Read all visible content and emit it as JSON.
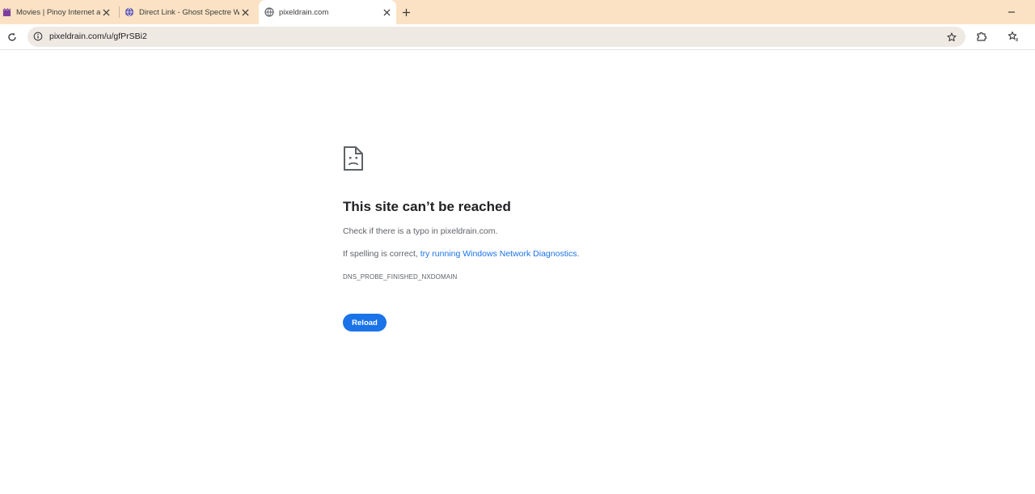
{
  "browser": {
    "tabs": [
      {
        "title": "Movies | Pinoy Internet and",
        "favicon": "film-icon",
        "active": false
      },
      {
        "title": "Direct Link - Ghost Spectre Wi",
        "favicon": "globe-purple-icon",
        "active": false
      },
      {
        "title": "pixeldrain.com",
        "favicon": "globe-icon",
        "active": true
      }
    ],
    "new_tab_icon": "plus-icon",
    "minimize_icon": "minimize-icon",
    "address": "pixeldrain.com/u/gfPrSBi2",
    "site_info_icon": "info-icon",
    "bookmark_icon": "star-icon",
    "extensions_icon": "puzzle-icon",
    "bookmarks_icon": "star-list-icon",
    "reload_icon": "reload-icon"
  },
  "error_page": {
    "icon": "sad-document-icon",
    "title": "This site can’t be reached",
    "line1": "Check if there is a typo in pixeldrain.com.",
    "line2_prefix": "If spelling is correct, ",
    "line2_link": "try running Windows Network Diagnostics",
    "line2_suffix": ".",
    "error_code": "DNS_PROBE_FINISHED_NXDOMAIN",
    "reload_label": "Reload"
  },
  "colors": {
    "tabstrip_bg": "#fbe2c4",
    "omnibox_bg": "#efe9e4",
    "accent": "#1a73e8"
  }
}
